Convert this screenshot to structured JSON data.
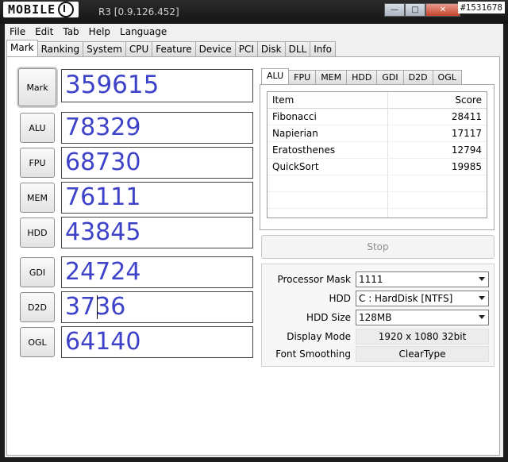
{
  "titlebar": {
    "brand": "MOBILE",
    "version": "R3 [0.9.126.452]",
    "watermark": "#1531678"
  },
  "menu": [
    "File",
    "Edit",
    "Tab",
    "Help",
    "Language"
  ],
  "tabs": [
    "Mark",
    "Ranking",
    "System",
    "CPU",
    "Feature",
    "Device",
    "PCI",
    "Disk",
    "DLL",
    "Info"
  ],
  "scores": {
    "mark": {
      "label": "Mark",
      "value": "359615"
    },
    "alu": {
      "label": "ALU",
      "value": "78329"
    },
    "fpu": {
      "label": "FPU",
      "value": "68730"
    },
    "mem": {
      "label": "MEM",
      "value": "76111"
    },
    "hdd": {
      "label": "HDD",
      "value": "43845"
    },
    "gdi": {
      "label": "GDI",
      "value": "24724"
    },
    "d2d": {
      "label": "D2D",
      "value": "3736"
    },
    "ogl": {
      "label": "OGL",
      "value": "64140"
    }
  },
  "subtabs": [
    "ALU",
    "FPU",
    "MEM",
    "HDD",
    "GDI",
    "D2D",
    "OGL"
  ],
  "list": {
    "headers": [
      "Item",
      "Score"
    ],
    "rows": [
      {
        "item": "Fibonacci",
        "score": "28411"
      },
      {
        "item": "Napierian",
        "score": "17117"
      },
      {
        "item": "Eratosthenes",
        "score": "12794"
      },
      {
        "item": "QuickSort",
        "score": "19985"
      }
    ]
  },
  "stop_label": "Stop",
  "settings": {
    "processor_mask_label": "Processor Mask",
    "processor_mask_value": "1111",
    "hdd_label": "HDD",
    "hdd_value": "C : HardDisk [NTFS]",
    "hdd_size_label": "HDD Size",
    "hdd_size_value": "128MB",
    "display_mode_label": "Display Mode",
    "display_mode_value": "1920 x 1080 32bit",
    "font_smoothing_label": "Font Smoothing",
    "font_smoothing_value": "ClearType"
  }
}
